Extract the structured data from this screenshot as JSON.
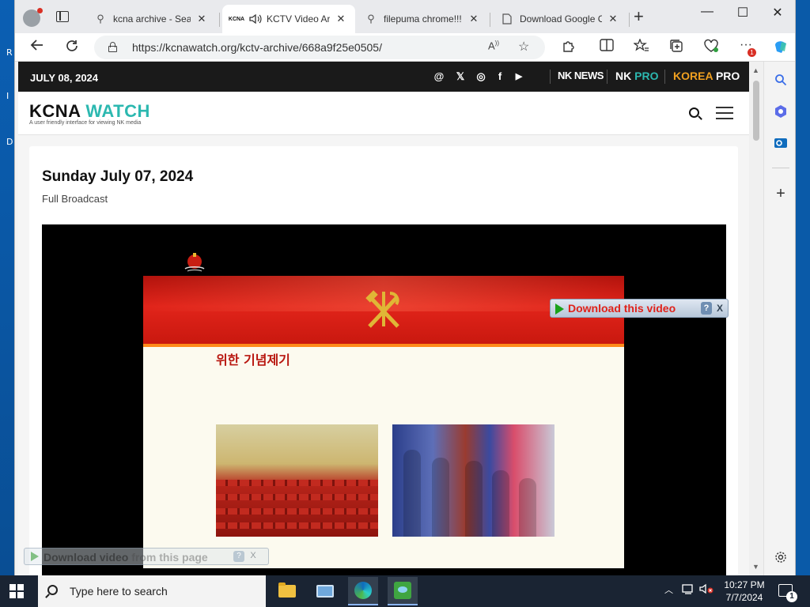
{
  "desktop": {
    "letters": [
      "R",
      "I",
      "D"
    ]
  },
  "browser": {
    "tabs": [
      {
        "title": "kcna archive - Search",
        "icon": "search-icon",
        "active": false
      },
      {
        "title": "KCTV Video Archive",
        "icon": "kcna-favicon",
        "favicon_text": "KCNA",
        "audio_icon": "speaker-icon",
        "active": true
      },
      {
        "title": "filepuma chrome!!!",
        "icon": "search-icon",
        "active": false
      },
      {
        "title": "Download Google Chrome",
        "icon": "page-icon",
        "active": false
      }
    ],
    "new_tab_label": "+",
    "window_controls": {
      "minimize": "—",
      "maximize": "☐",
      "close": "✕"
    },
    "address": {
      "url": "https://kcnawatch.org/kctv-archive/668a9f25e0505/"
    },
    "toolbar_badge": "1"
  },
  "site": {
    "date": "JULY 08, 2024",
    "social": [
      "@",
      "𝕏",
      "◎",
      "f",
      "▶"
    ],
    "brands": [
      {
        "text": "NK NEWS",
        "color": "#ffffff"
      },
      {
        "text": "NK PRO",
        "part1": "NK ",
        "part2": "PRO",
        "color": "#2cb8b0"
      },
      {
        "text": "KOREA PRO",
        "part1": "KOREA ",
        "part2": "PRO",
        "color": "#f0a020"
      }
    ],
    "logo_part1": "KCNA",
    "logo_part2": "WATCH",
    "tagline": "A user friendly interface for viewing NK media",
    "accent_color": "#2cb8b0"
  },
  "content": {
    "title": "Sunday July 07, 2024",
    "subtitle": "Full Broadcast",
    "video_caption": "위한 기념제기"
  },
  "download_overlay": {
    "label": "Download this video",
    "help": "?",
    "close": "X"
  },
  "page_download": {
    "label_main": "Download video",
    "label_rest": " from this page",
    "help": "?",
    "close": "X"
  },
  "taskbar": {
    "search_placeholder": "Type here to search",
    "time": "10:27 PM",
    "date": "7/7/2024",
    "notification_count": "1"
  }
}
